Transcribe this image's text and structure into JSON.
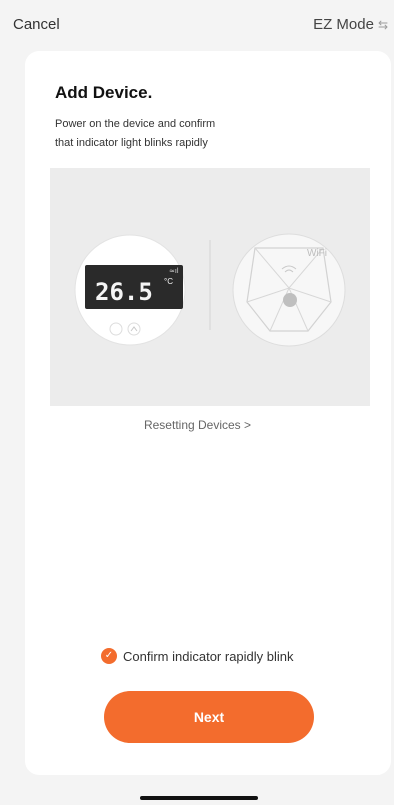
{
  "top_bar": {
    "cancel_label": "Cancel",
    "mode_label": "EZ Mode",
    "mode_icon": "swap-horizontal-icon"
  },
  "card": {
    "title": "Add Device.",
    "instruction_line_1": "Power on the device and confirm",
    "instruction_line_2": "that indicator light blinks rapidly",
    "illustration": {
      "thermostat_reading": "26.5",
      "thermostat_unit": "°C",
      "router_label": "WiFi"
    },
    "reset_link_label": "Resetting Devices >",
    "confirm_label": "Confirm indicator rapidly blink",
    "confirm_checked": true,
    "next_button_label": "Next"
  },
  "colors": {
    "accent": "#f36c2d",
    "card_background": "#ffffff",
    "page_background": "#f4f4f4",
    "illustration_background": "#ececec"
  }
}
